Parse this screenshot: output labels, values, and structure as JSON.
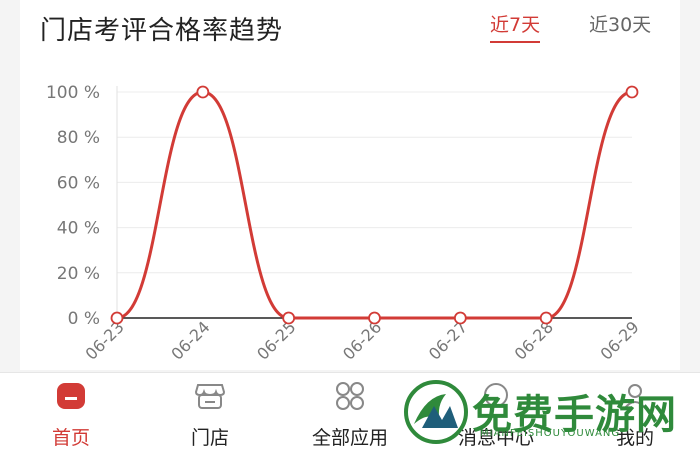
{
  "header": {
    "title": "门店考评合格率趋势",
    "tabs": [
      {
        "label": "近7天",
        "active": true
      },
      {
        "label": "近30天",
        "active": false
      }
    ]
  },
  "chart_data": {
    "type": "line",
    "categories": [
      "06-23",
      "06-24",
      "06-25",
      "06-26",
      "06-27",
      "06-28",
      "06-29"
    ],
    "series": [
      {
        "values": [
          0,
          100,
          0,
          0,
          0,
          0,
          100
        ]
      }
    ],
    "y_tick_labels": [
      "0 %",
      "20 %",
      "40 %",
      "60 %",
      "80 %",
      "100 %"
    ],
    "ylim": [
      0,
      100
    ],
    "grid": true,
    "smooth": true,
    "line_color": "#d23b36"
  },
  "bottom_nav": {
    "items": [
      {
        "label": "首页",
        "icon": "home-icon",
        "active": true
      },
      {
        "label": "门店",
        "icon": "store-icon",
        "active": false
      },
      {
        "label": "全部应用",
        "icon": "apps-icon",
        "active": false
      },
      {
        "label": "消息中心",
        "icon": "message-icon",
        "active": false
      },
      {
        "label": "我的",
        "icon": "profile-icon",
        "active": false
      }
    ]
  },
  "watermark": {
    "text": "免费手游网",
    "sub": "MIANFEISHOUYOUWANG"
  },
  "colors": {
    "accent": "#d23b36",
    "watermark": "#2f8a3b"
  }
}
